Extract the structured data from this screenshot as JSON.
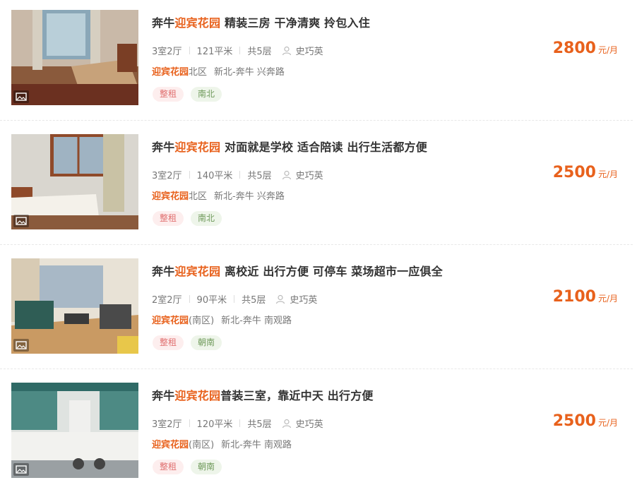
{
  "listings": [
    {
      "title_prefix": "奔牛",
      "title_highlight": "迎宾花园",
      "title_suffix": " 精装三房 干净清爽 拎包入住",
      "rooms": "3室2厅",
      "area": "121平米",
      "floors": "共5层",
      "agent": "史巧英",
      "addr_highlight": "迎宾花园",
      "addr_suffix": "北区",
      "district": "新北-奔牛 兴奔路",
      "tag_rent": "整租",
      "tag_direction": "南北",
      "price": "2800",
      "price_unit": "元/月",
      "photo_icon": "image-icon"
    },
    {
      "title_prefix": "奔牛",
      "title_highlight": "迎宾花园",
      "title_suffix": " 对面就是学校 适合陪读 出行生活都方便",
      "rooms": "3室2厅",
      "area": "140平米",
      "floors": "共5层",
      "agent": "史巧英",
      "addr_highlight": "迎宾花园",
      "addr_suffix": "北区",
      "district": "新北-奔牛 兴奔路",
      "tag_rent": "整租",
      "tag_direction": "南北",
      "price": "2500",
      "price_unit": "元/月",
      "photo_icon": "image-icon"
    },
    {
      "title_prefix": "奔牛",
      "title_highlight": "迎宾花园",
      "title_suffix": " 离校近 出行方便 可停车 菜场超市一应俱全",
      "rooms": "2室2厅",
      "area": "90平米",
      "floors": "共5层",
      "agent": "史巧英",
      "addr_highlight": "迎宾花园",
      "addr_suffix": "(南区)",
      "district": "新北-奔牛 南观路",
      "tag_rent": "整租",
      "tag_direction": "朝南",
      "price": "2100",
      "price_unit": "元/月",
      "photo_icon": "image-icon"
    },
    {
      "title_prefix": "奔牛",
      "title_highlight": "迎宾花园",
      "title_suffix": "普装三室，靠近中天 出行方便",
      "rooms": "3室2厅",
      "area": "120平米",
      "floors": "共5层",
      "agent": "史巧英",
      "addr_highlight": "迎宾花园",
      "addr_suffix": "(南区)",
      "district": "新北-奔牛 南观路",
      "tag_rent": "整租",
      "tag_direction": "朝南",
      "price": "2500",
      "price_unit": "元/月",
      "photo_icon": "image-icon"
    }
  ],
  "colors": {
    "accent": "#e8611c",
    "rent_tag_bg": "#fdeeee",
    "direction_tag_bg": "#eef5ea"
  }
}
